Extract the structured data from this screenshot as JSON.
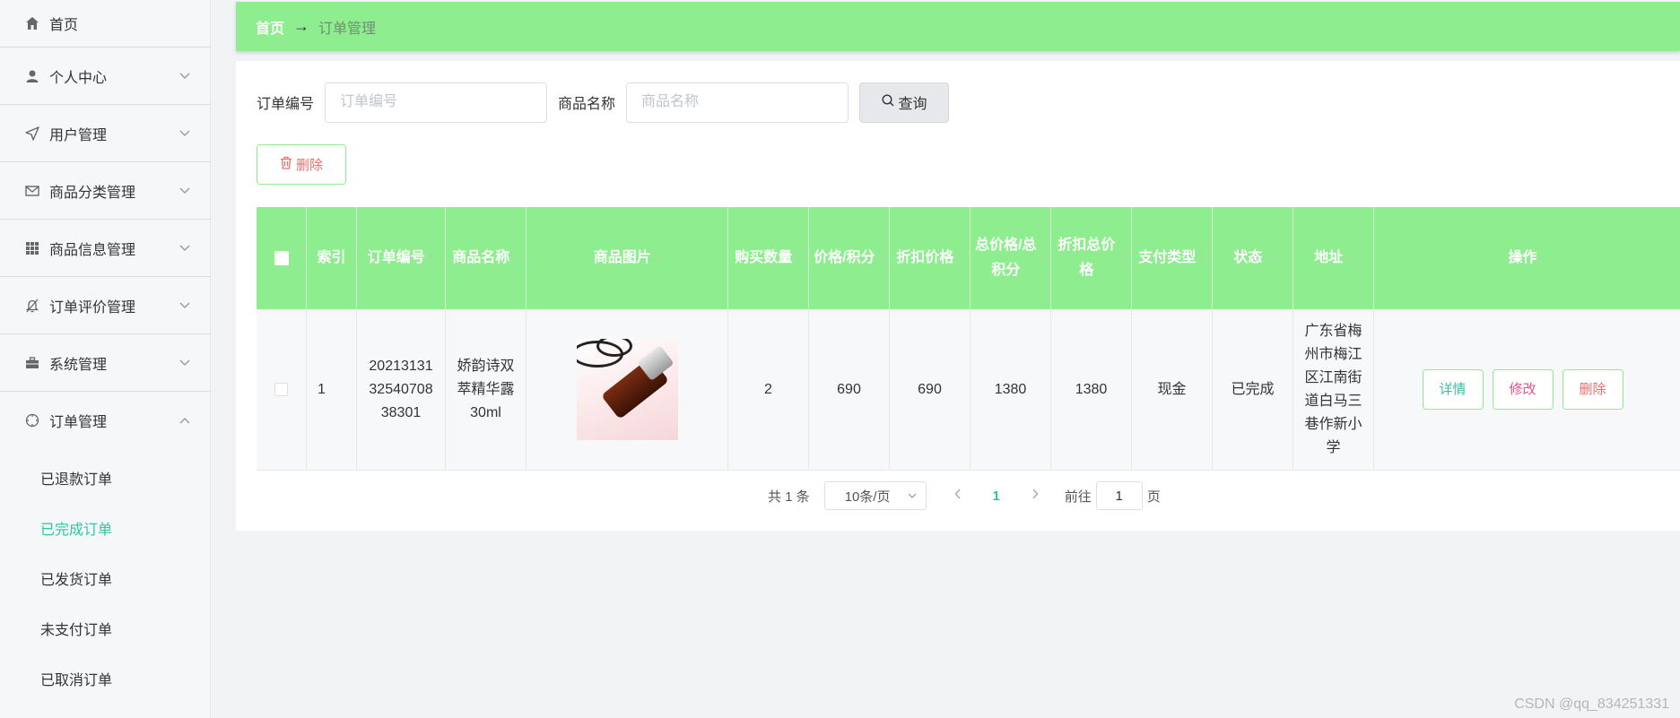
{
  "sidebar": {
    "items": [
      {
        "label": "首页",
        "icon": "home-icon",
        "arrow": ""
      },
      {
        "label": "个人中心",
        "icon": "user-icon",
        "arrow": "⌵"
      },
      {
        "label": "用户管理",
        "icon": "send-icon",
        "arrow": "⌵"
      },
      {
        "label": "商品分类管理",
        "icon": "mail-icon",
        "arrow": "⌵"
      },
      {
        "label": "商品信息管理",
        "icon": "grid-icon",
        "arrow": "⌵"
      },
      {
        "label": "订单评价管理",
        "icon": "bell-off-icon",
        "arrow": "⌵"
      },
      {
        "label": "系统管理",
        "icon": "briefcase-icon",
        "arrow": "⌵"
      },
      {
        "label": "订单管理",
        "icon": "compass-icon",
        "arrow": "⌃"
      }
    ],
    "sub_items": [
      {
        "label": "已退款订单"
      },
      {
        "label": "已完成订单"
      },
      {
        "label": "已发货订单"
      },
      {
        "label": "未支付订单"
      },
      {
        "label": "已取消订单"
      }
    ],
    "active_sub": "已完成订单"
  },
  "breadcrumb": {
    "home": "首页",
    "separator": "→",
    "current": "订单管理"
  },
  "search": {
    "order_no_label": "订单编号",
    "order_no_placeholder": "订单编号",
    "product_name_label": "商品名称",
    "product_name_placeholder": "商品名称",
    "query_label": "查询"
  },
  "toolbar": {
    "delete_label": "删除"
  },
  "table": {
    "columns": [
      "",
      "索引",
      "订单编号",
      "商品名称",
      "商品图片",
      "购买数量",
      "价格/积分",
      "折扣价格",
      "总价格/总积分",
      "折扣总价格",
      "支付类型",
      "状态",
      "地址",
      "操作"
    ],
    "rows": [
      {
        "index": "1",
        "order_no": "2021313132540708 38301",
        "order_no_lines": [
          "20213131",
          "32540708",
          "38301"
        ],
        "product_name_lines": [
          "娇韵诗双",
          "萃精华露",
          "30ml"
        ],
        "quantity": "2",
        "price": "690",
        "discount_price": "690",
        "total_price": "1380",
        "discount_total": "1380",
        "pay_type": "现金",
        "status": "已完成",
        "address_lines": [
          "广东省梅",
          "州市梅江",
          "区江南街",
          "道白马三",
          "巷作新小",
          "学"
        ],
        "actions": {
          "detail": "详情",
          "edit": "修改",
          "delete": "删除"
        }
      }
    ]
  },
  "pagination": {
    "total_text": "共 1 条",
    "page_size": "10条/页",
    "current_page": "1",
    "goto_label": "前往",
    "goto_value": "1",
    "page_unit": "页"
  },
  "watermark": "CSDN @qq_834251331",
  "colors": {
    "accent_green": "#8eed8f",
    "active_teal": "#2ec4a6",
    "danger": "#f06d6d"
  }
}
